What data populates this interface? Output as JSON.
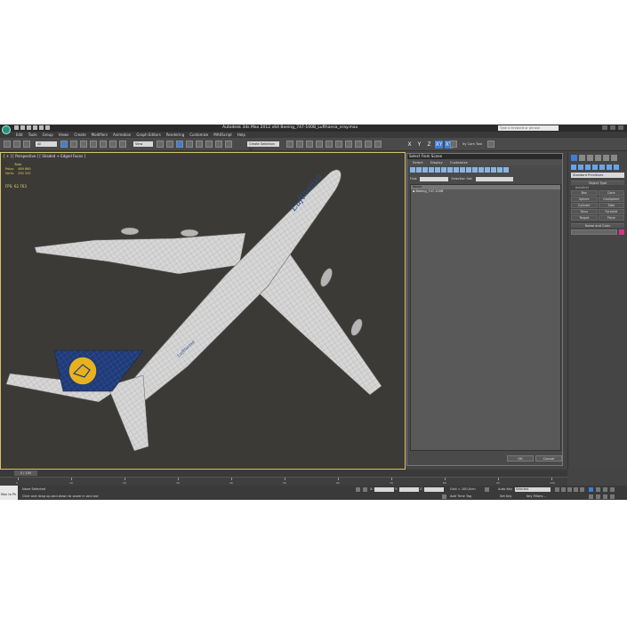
{
  "titlebar": {
    "title": "Autodesk 3ds Max  2012 x64    Boeing_747-100B_Lufthansa_vray.max",
    "search_placeholder": "Type a keyword or phrase"
  },
  "menu": [
    "Edit",
    "Tools",
    "Group",
    "Views",
    "Create",
    "Modifiers",
    "Animation",
    "Graph Editors",
    "Rendering",
    "Customize",
    "MAXScript",
    "Help"
  ],
  "toolbar": {
    "filter_value": "All",
    "refcoord_value": "View",
    "selection_set_placeholder": "Create Selection Se",
    "axis_labels": [
      "X",
      "Y",
      "Z",
      "XY",
      "XY"
    ],
    "extra_label": "ity Cam Tool"
  },
  "viewport": {
    "label": "[ + ] [ Perspective ] [ Shaded + Edged Faces ]",
    "stats": {
      "header": "Total",
      "polys_label": "Polys:",
      "polys_value": "489 860",
      "verts_label": "Verts:",
      "verts_value": "250 332",
      "fps_label": "FPS:",
      "fps_value": "62.763"
    },
    "livery_text": "Lufthansa"
  },
  "select_dialog": {
    "title": "Select From Scene",
    "menu": [
      "Select",
      "Display",
      "Customize"
    ],
    "find_label": "Find:",
    "selection_set_label": "Selection Set:",
    "column_header": "Name",
    "items": [
      "Boeing_747-100B"
    ],
    "ok_label": "OK",
    "cancel_label": "Cancel"
  },
  "command_panel": {
    "category": "Standard Primitives",
    "object_type_header": "Object Type",
    "autogrid_label": "AutoGrid",
    "objects": [
      "Box",
      "Cone",
      "Sphere",
      "GeoSphere",
      "Cylinder",
      "Tube",
      "Torus",
      "Pyramid",
      "Teapot",
      "Plane"
    ],
    "name_color_header": "Name and Color"
  },
  "timeline": {
    "slider_label": "0 / 100",
    "ticks": [
      "0",
      "10",
      "20",
      "30",
      "40",
      "50",
      "60",
      "70",
      "80",
      "90",
      "100"
    ]
  },
  "status": {
    "maxscript_label": "Max to Ph",
    "selection_text": "None Selected",
    "prompt_text": "Click and drag up-and-down to zoom in and out",
    "x_label": "X:",
    "y_label": "Y:",
    "z_label": "Z:",
    "grid_text": "Grid = 100,0cm",
    "add_time_tag": "Add Time Tag",
    "autokey_label": "Auto Key",
    "autokey_value": "Selected",
    "setkey_label": "Set Key",
    "keyfilters_label": "Key Filters..."
  },
  "colors": {
    "viewport_bg": "#3b3a36",
    "selection_border": "#d9c36a",
    "tail_blue": "#1e3a78",
    "logo_yellow": "#e8b21e",
    "accent_blue": "#3d7fd4"
  }
}
